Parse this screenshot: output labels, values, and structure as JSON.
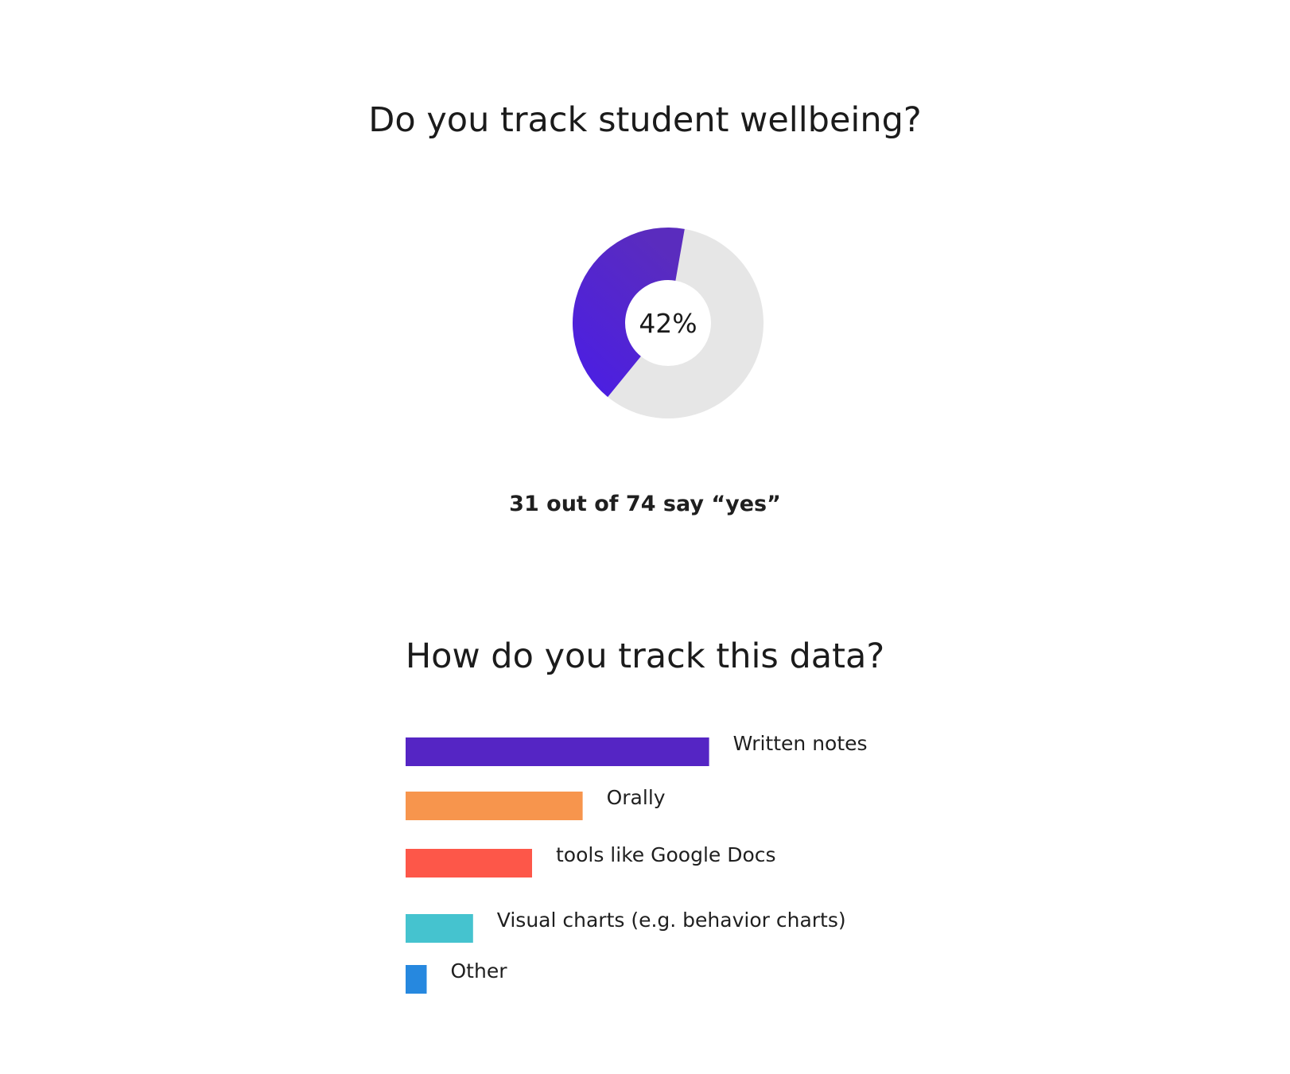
{
  "chart_data": [
    {
      "type": "pie",
      "title": "Do you track student wellbeing?",
      "center_label": "42%",
      "caption": "31 out of 74 say “yes”",
      "yes_count": 31,
      "total": 74,
      "values": [
        31,
        43
      ],
      "colors": [
        "#5225dc",
        "#e6e6e6"
      ]
    },
    {
      "type": "bar",
      "orientation": "horizontal",
      "title": "How do you track this data?",
      "categories": [
        "Written notes",
        "Orally",
        "tools like Google Docs",
        "Visual charts (e.g. behavior charts)",
        "Other"
      ],
      "values": [
        14.4,
        8.4,
        6.0,
        3.2,
        1.0
      ],
      "colors": [
        "#5525c4",
        "#f7954d",
        "#fd5749",
        "#45c3cf",
        "#2688df"
      ]
    }
  ]
}
